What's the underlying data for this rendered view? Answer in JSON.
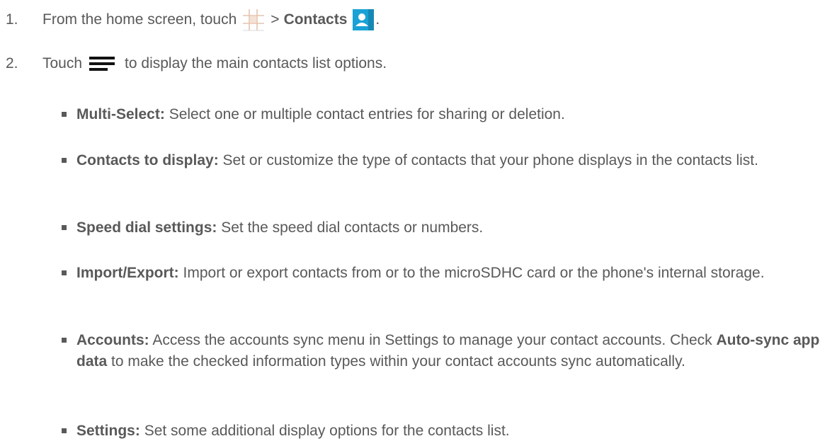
{
  "steps": [
    {
      "number": "1.",
      "text_before": "From the home screen, touch",
      "separator": ">",
      "bold_label": "Contacts",
      "text_after": "."
    },
    {
      "number": "2.",
      "text_before": "Touch",
      "text_after": "to display the main contacts list options."
    }
  ],
  "icons": {
    "apps": "apps-grid-icon",
    "contacts": "contacts-app-icon",
    "menu": "menu-icon"
  },
  "colors": {
    "text": "#595959",
    "contacts_icon": "#1aa1d6",
    "grid_icon": "#e8c9b7"
  },
  "options": [
    {
      "label": "Multi-Select:",
      "description": "Select one or multiple contact entries for sharing or deletion."
    },
    {
      "label": "Contacts to display:",
      "description": "Set or customize the type of contacts that your phone displays in the contacts list."
    },
    {
      "label": "Speed dial settings:",
      "description": "Set the speed dial contacts or numbers."
    },
    {
      "label": "Import/Export:",
      "description": "Import or export contacts from or to the microSDHC card or the phone's internal storage."
    },
    {
      "label": "Accounts:",
      "description": "Access the accounts sync menu in Settings to manage your contact accounts. Check",
      "inline_bold": "Auto-sync app data",
      "description_after": "to make the checked information types within your contact accounts sync automatically."
    },
    {
      "label": "Settings:",
      "description": "Set some additional display options for the contacts list."
    }
  ]
}
